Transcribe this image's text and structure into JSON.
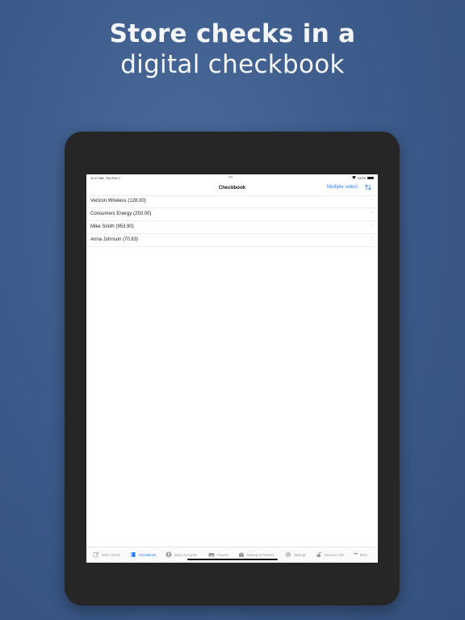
{
  "headline": {
    "line1": "Store checks in a",
    "line2": "digital checkbook"
  },
  "status_bar": {
    "time": "11:17 AM",
    "date": "Thu Feb 1",
    "dots": "•••",
    "battery": "100%"
  },
  "nav": {
    "title": "Checkbook",
    "multiple_select": "Multiple select",
    "sort_icon": "sort-arrows-icon"
  },
  "checks": [
    {
      "label": "Verizon Wireless (128.00)"
    },
    {
      "label": "Consumers Energy (250.00)"
    },
    {
      "label": "Mike Smith (953.90)"
    },
    {
      "label": "Anna Johnson (70.83)"
    }
  ],
  "tabs": [
    {
      "label": "Write Check",
      "icon": "edit-icon",
      "active": false
    },
    {
      "label": "Checkbook",
      "icon": "book-icon",
      "active": true
    },
    {
      "label": "Bank Accounts",
      "icon": "person-icon",
      "active": false
    },
    {
      "label": "Payees",
      "icon": "keyboard-icon",
      "active": false
    },
    {
      "label": "Backup & Restore",
      "icon": "briefcase-icon",
      "active": false
    },
    {
      "label": "Settings",
      "icon": "gear-icon",
      "active": false
    },
    {
      "label": "Remove Ads",
      "icon": "lock-icon",
      "active": false
    },
    {
      "label": "More",
      "icon": "more-icon",
      "active": false
    }
  ],
  "colors": {
    "accent": "#2b7cf6",
    "background": "#3d5c8c",
    "device": "#262626"
  }
}
